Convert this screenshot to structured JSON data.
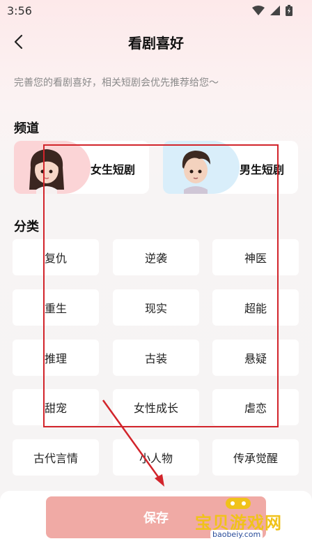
{
  "status": {
    "time": "3:56"
  },
  "header": {
    "title": "看剧喜好"
  },
  "subtitle": "完善您的看剧喜好，相关短剧会优先推荐给您～",
  "channel": {
    "title": "频道",
    "cards": [
      {
        "label": "女生短剧"
      },
      {
        "label": "男生短剧"
      }
    ]
  },
  "category": {
    "title": "分类",
    "tags": [
      "复仇",
      "逆袭",
      "神医",
      "重生",
      "现实",
      "超能",
      "推理",
      "古装",
      "悬疑",
      "甜宠",
      "女性成长",
      "虐恋",
      "古代言情",
      "小人物",
      "传承觉醒"
    ]
  },
  "save_label": "保存",
  "watermark": {
    "text": "宝贝游戏网",
    "url": "baobeiy.com"
  },
  "colors": {
    "accent": "#f0aaa5",
    "annotation": "#d2242b"
  }
}
